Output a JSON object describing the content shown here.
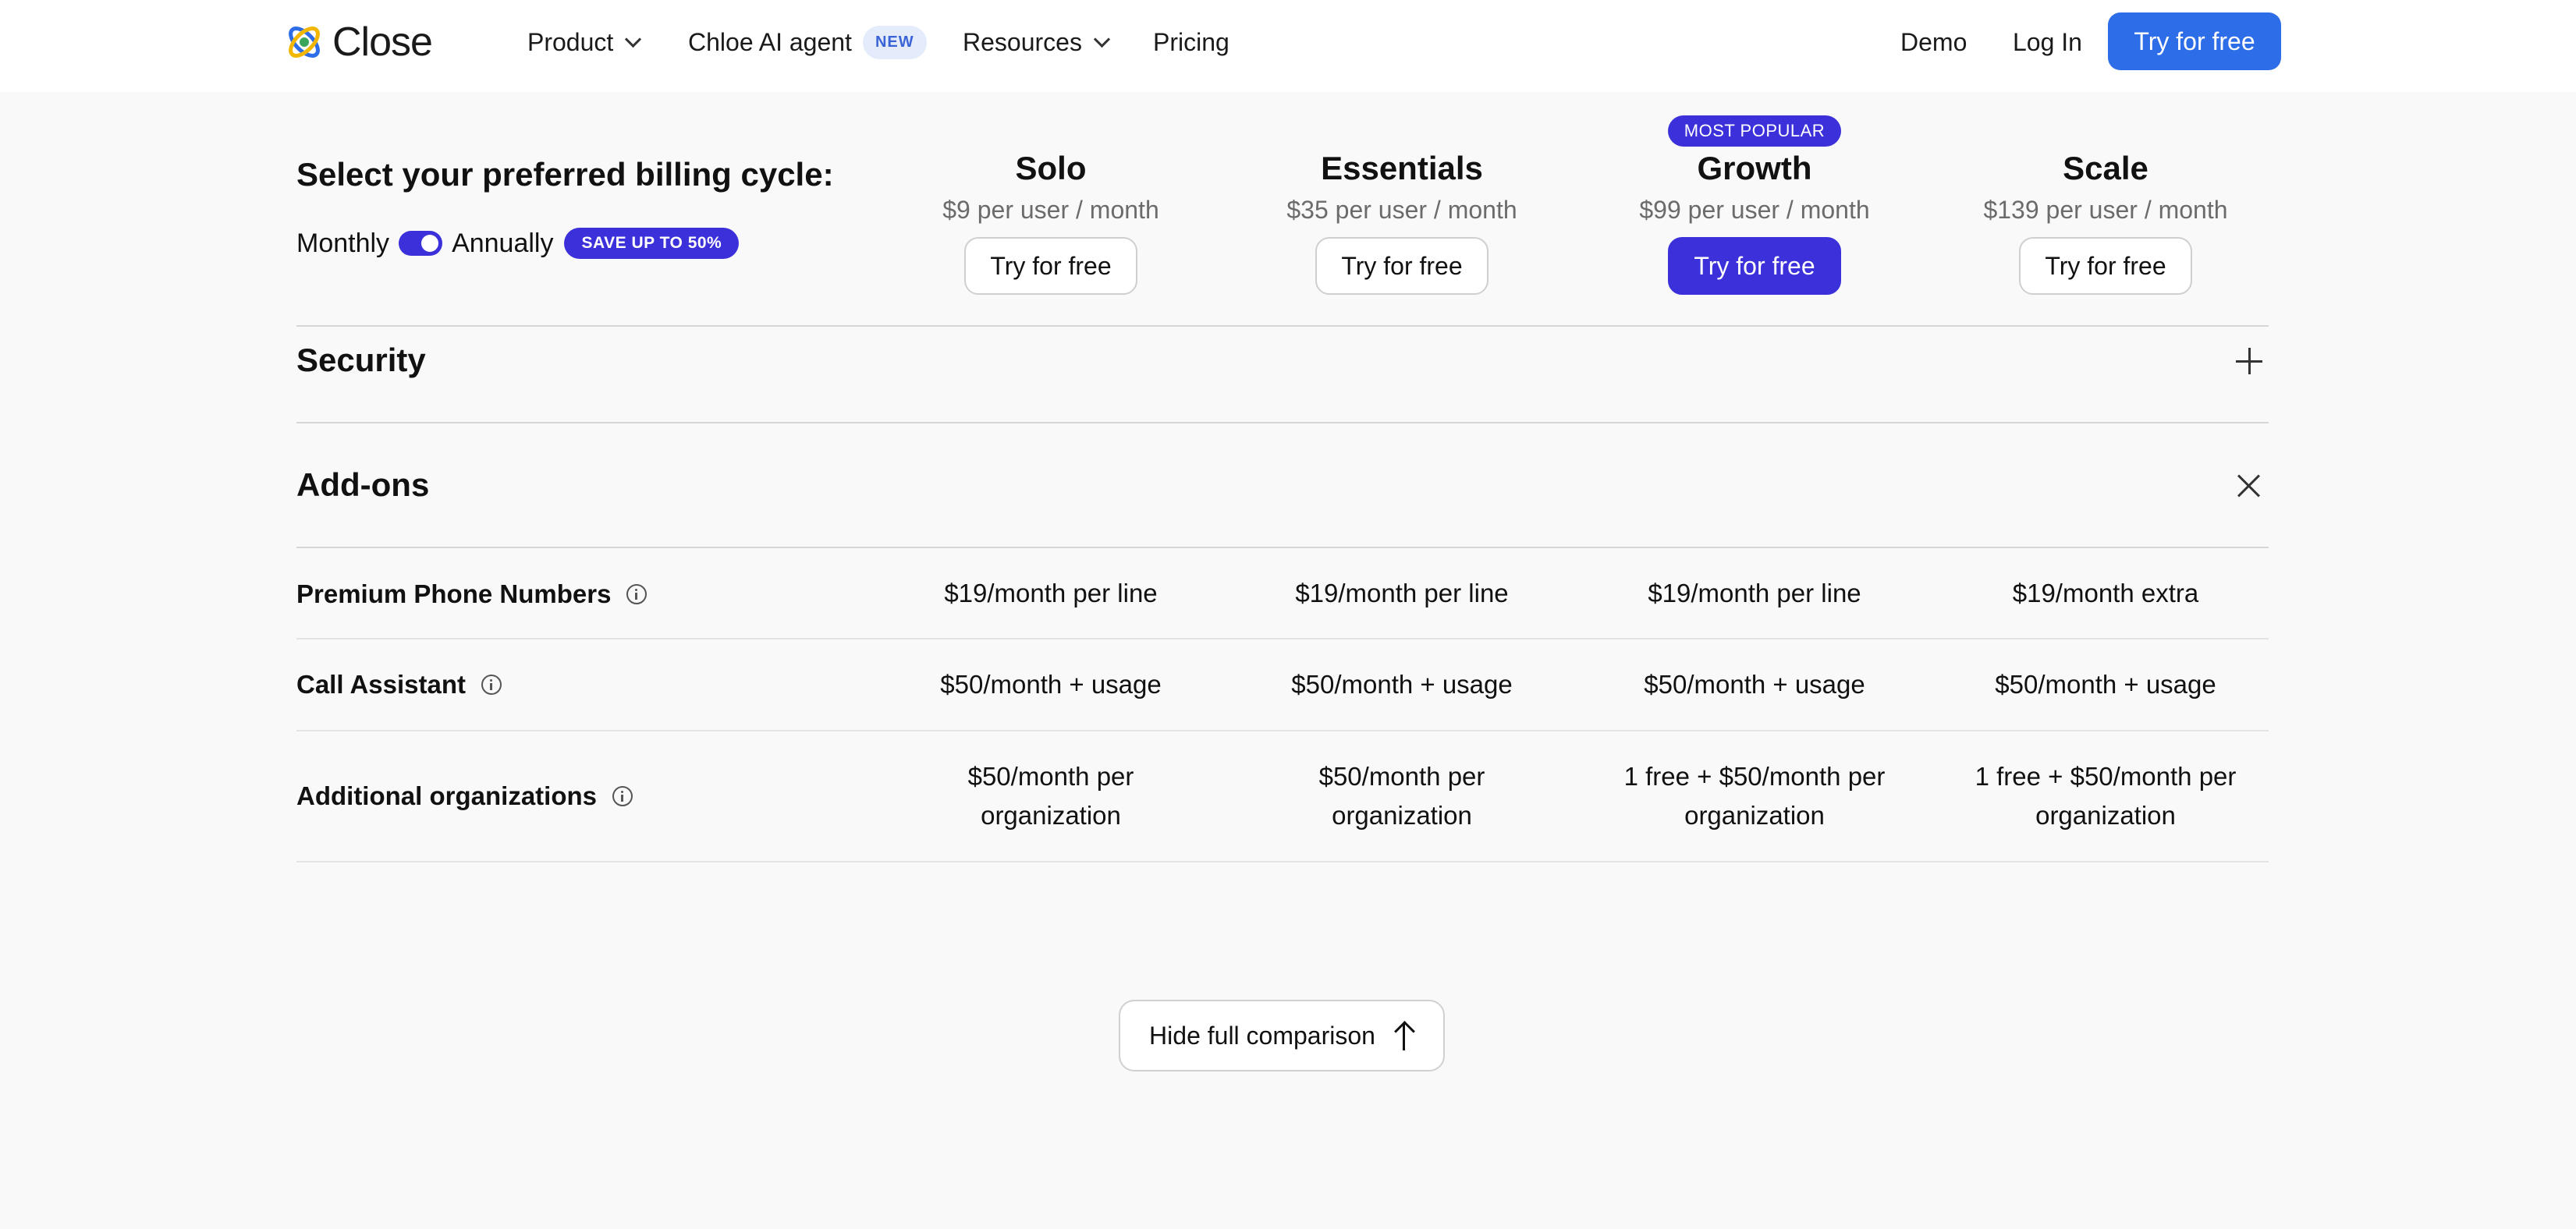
{
  "nav": {
    "logo_text": "Close",
    "product": "Product",
    "chloe": "Chloe AI agent",
    "new_badge": "NEW",
    "resources": "Resources",
    "pricing": "Pricing",
    "demo": "Demo",
    "login": "Log In",
    "cta": "Try for free"
  },
  "billing": {
    "title": "Select your preferred billing cycle:",
    "monthly": "Monthly",
    "annually": "Annually",
    "save_badge": "SAVE UP TO 50%"
  },
  "plans": [
    {
      "name": "Solo",
      "price": "$9 per user / month",
      "button": "Try for free"
    },
    {
      "name": "Essentials",
      "price": "$35 per user / month",
      "button": "Try for free"
    },
    {
      "name": "Growth",
      "price": "$99 per user / month",
      "button": "Try for free"
    },
    {
      "name": "Scale",
      "price": "$139 per user / month",
      "button": "Try for free"
    }
  ],
  "most_popular": "MOST POPULAR",
  "sections": {
    "security": "Security",
    "addons": "Add-ons"
  },
  "addons": [
    {
      "label": "Premium Phone Numbers",
      "values": [
        "$19/month per line",
        "$19/month per line",
        "$19/month per line",
        "$19/month extra"
      ]
    },
    {
      "label": "Call Assistant",
      "values": [
        "$50/month + usage",
        "$50/month + usage",
        "$50/month + usage",
        "$50/month + usage"
      ]
    },
    {
      "label": "Additional organizations",
      "values": [
        "$50/month per\norganization",
        "$50/month per\norganization",
        "1 free + $50/month per\norganization",
        "1 free + $50/month per\norganization"
      ]
    }
  ],
  "hide_comparison": "Hide full comparison",
  "colors": {
    "accent": "#3b30d9",
    "nav_cta": "#2e6de8",
    "background": "#f9f9f9"
  }
}
